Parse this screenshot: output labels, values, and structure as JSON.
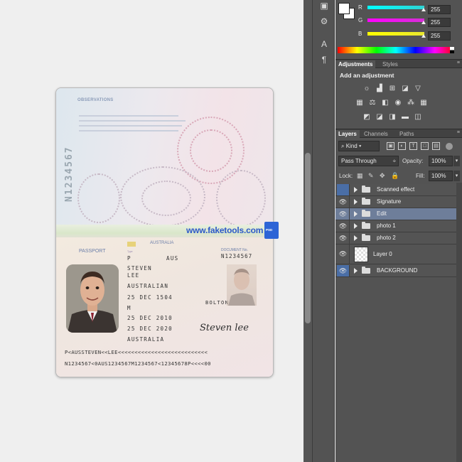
{
  "canvas": {
    "passport": {
      "observations_title": "OBSERVATIONS",
      "perforation": "N1234567",
      "page_label": "PASSPORT",
      "country_name": "AUSTRALIA",
      "document_no_label": "DOCUMENT No.",
      "type_value": "P",
      "code_value": "AUS",
      "document_no_value": "N1234567",
      "surname_value": "STEVEN",
      "given_value": "LEE",
      "nationality_value": "AUSTRALIAN",
      "dob_value": "25 DEC 1504",
      "sex_value": "M",
      "pob_value": "BOLTON",
      "issue_value": "25 DEC 2010",
      "expiry_value": "25 DEC 2020",
      "authority_value": "AUSTRALIA",
      "signature": "Steven lee",
      "mrz_line1": "P<AUSSTEVEN<<LEE<<<<<<<<<<<<<<<<<<<<<<<<<<<",
      "mrz_line2": "N1234567<0AUS1234567M1234567<12345678P<<<<00"
    },
    "watermark": "www.faketools.com",
    "watermark_badge": "PSD"
  },
  "color_panel": {
    "channels": [
      {
        "label": "R",
        "value": "255",
        "color": "#2fd3d3"
      },
      {
        "label": "G",
        "value": "255",
        "color": "#d62fd6"
      },
      {
        "label": "B",
        "value": "255",
        "color": "#e8e62f"
      }
    ]
  },
  "adjustments": {
    "tabs": [
      "Adjustments",
      "Styles"
    ],
    "title": "Add an adjustment"
  },
  "layers": {
    "tabs": [
      "Layers",
      "Channels",
      "Paths"
    ],
    "filter_kind": "Kind",
    "blend_mode": "Pass Through",
    "opacity_label": "Opacity:",
    "opacity_value": "100%",
    "lock_label": "Lock:",
    "fill_label": "Fill:",
    "fill_value": "100%",
    "items": [
      {
        "name": "Scanned effect",
        "visible": false,
        "selected": false
      },
      {
        "name": "Signature",
        "visible": true,
        "selected": false
      },
      {
        "name": "Edit",
        "visible": true,
        "selected": true
      },
      {
        "name": "photo 1",
        "visible": true,
        "selected": false
      },
      {
        "name": "photo 2",
        "visible": true,
        "selected": false
      },
      {
        "name": "Layer 0",
        "visible": true,
        "selected": false
      },
      {
        "name": "BACKGROUND",
        "visible": true,
        "selected": false
      }
    ]
  }
}
